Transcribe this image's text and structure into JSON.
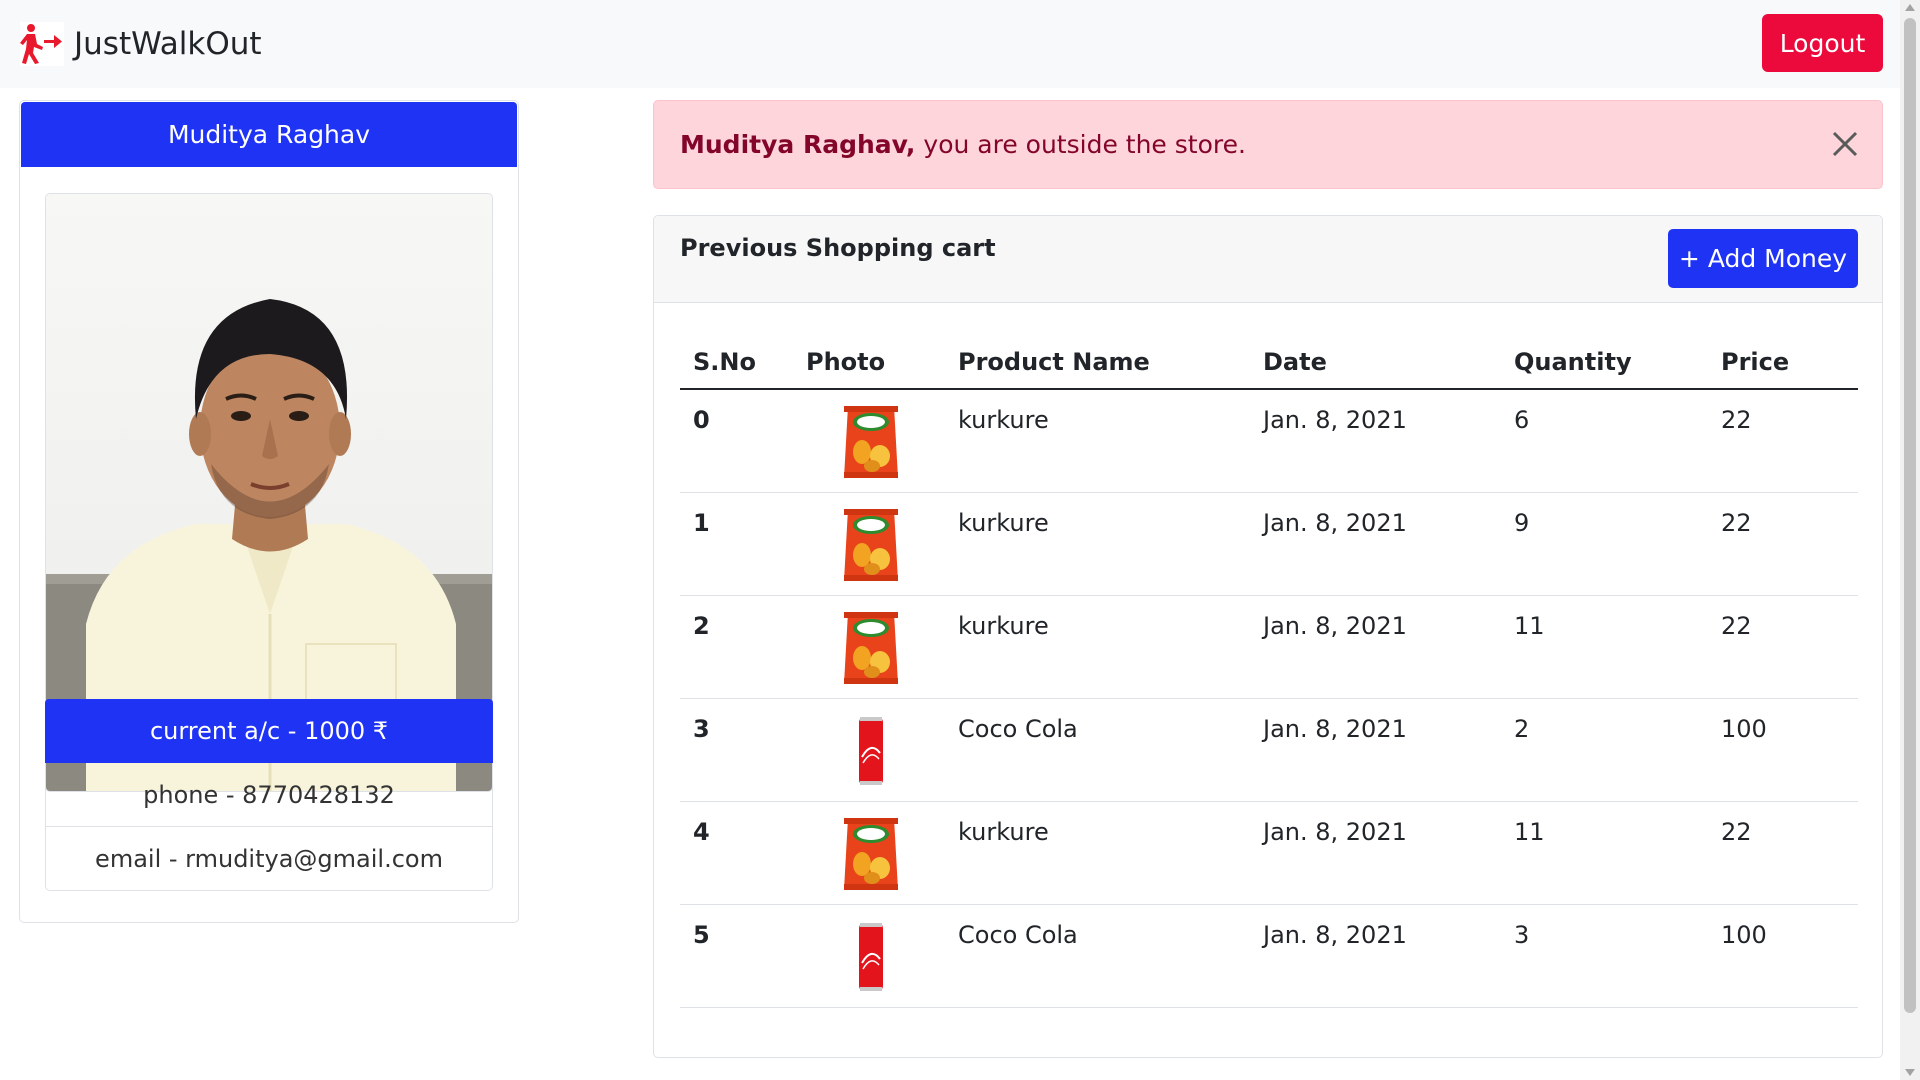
{
  "navbar": {
    "brand_name": "JustWalkOut",
    "brand_icon": "walking-exit-icon",
    "logout_label": "Logout"
  },
  "profile": {
    "name": "Muditya Raghav",
    "account": "current a/c - 1000 ₹",
    "phone": "phone - 8770428132",
    "email": "email - rmuditya@gmail.com"
  },
  "alert": {
    "name": "Muditya Raghav,",
    "message": "you are outside the store.",
    "bg_color": "#fdd5db",
    "text_color": "#83062a"
  },
  "cart": {
    "title": "Previous Shopping cart",
    "add_money_label": "+ Add Money",
    "columns": [
      "S.No",
      "Photo",
      "Product Name",
      "Date",
      "Quantity",
      "Price"
    ],
    "rows": [
      {
        "sno": "0",
        "photo": "kurkure-pack",
        "name": "kurkure",
        "date": "Jan. 8, 2021",
        "quantity": "6",
        "price": "22"
      },
      {
        "sno": "1",
        "photo": "kurkure-pack",
        "name": "kurkure",
        "date": "Jan. 8, 2021",
        "quantity": "9",
        "price": "22"
      },
      {
        "sno": "2",
        "photo": "kurkure-pack",
        "name": "kurkure",
        "date": "Jan. 8, 2021",
        "quantity": "11",
        "price": "22"
      },
      {
        "sno": "3",
        "photo": "coca-cola-can",
        "name": "Coco Cola",
        "date": "Jan. 8, 2021",
        "quantity": "2",
        "price": "100"
      },
      {
        "sno": "4",
        "photo": "kurkure-pack",
        "name": "kurkure",
        "date": "Jan. 8, 2021",
        "quantity": "11",
        "price": "22"
      },
      {
        "sno": "5",
        "photo": "coca-cola-can",
        "name": "Coco Cola",
        "date": "Jan. 8, 2021",
        "quantity": "3",
        "price": "100"
      }
    ]
  },
  "colors": {
    "primary": "#1f33f5",
    "danger": "#ec0a3c",
    "navbar_bg": "#f8f9fa"
  }
}
